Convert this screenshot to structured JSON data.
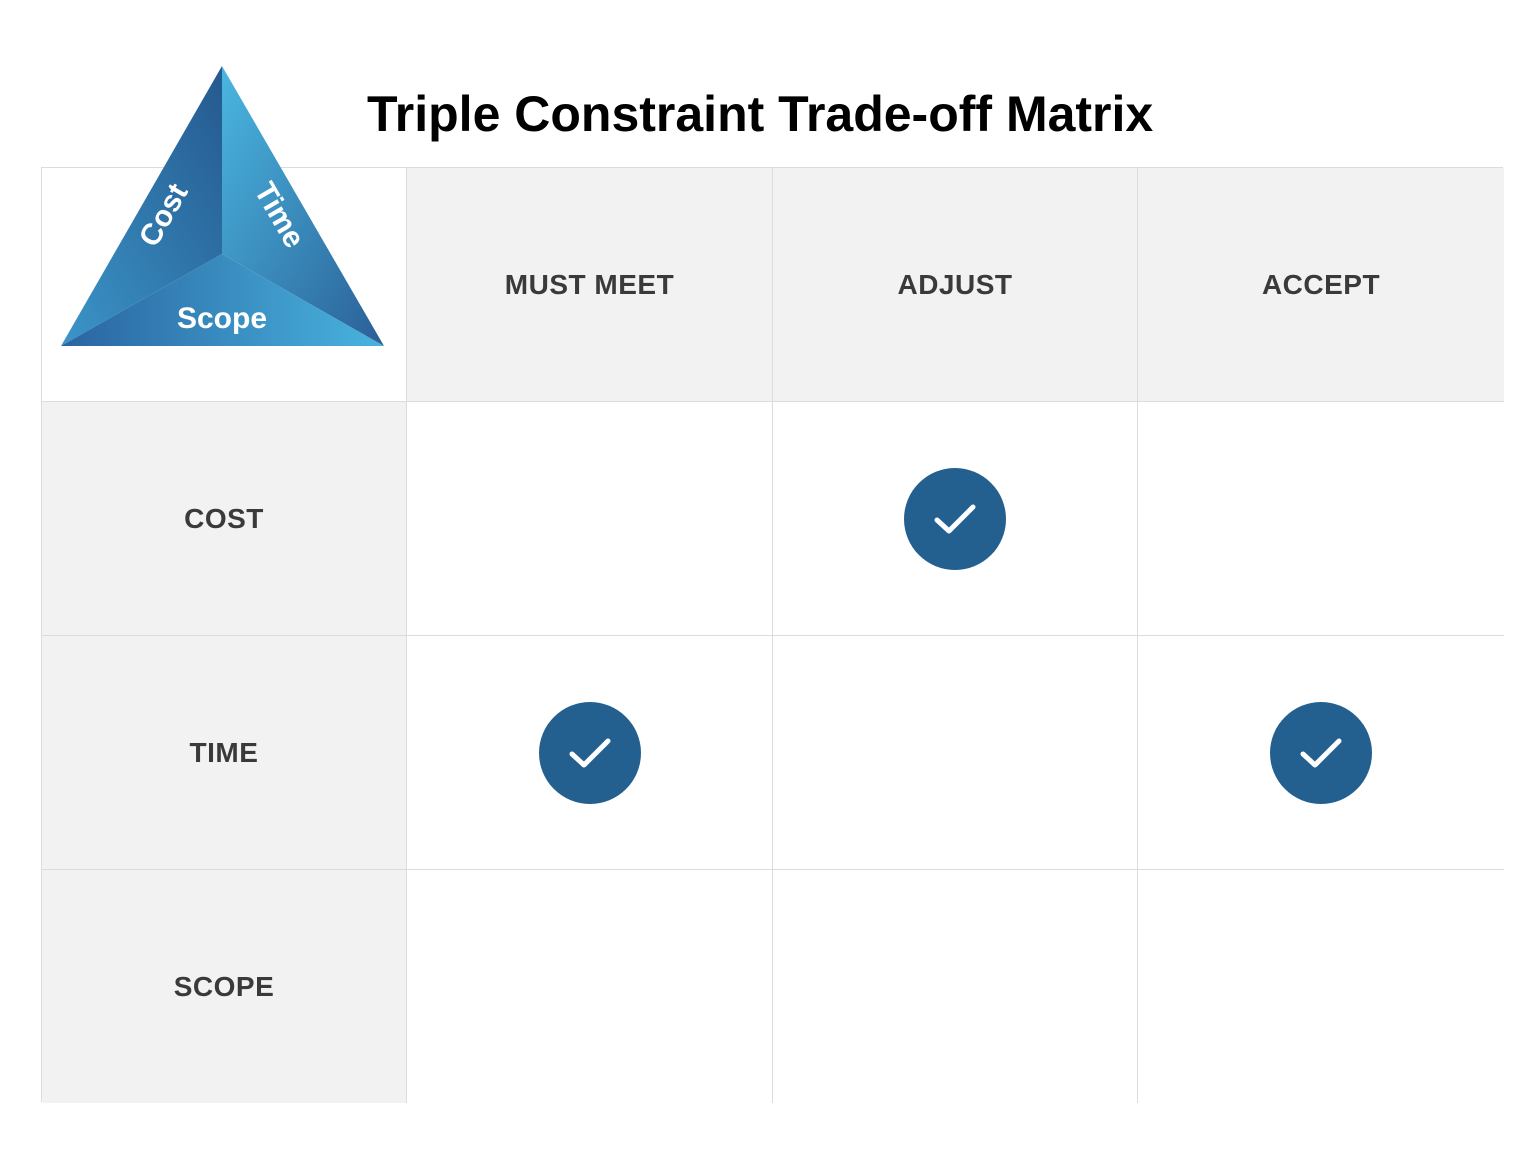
{
  "title": "Triple Constraint Trade-off Matrix",
  "triangle": {
    "labels": {
      "cost": "Cost",
      "time": "Time",
      "scope": "Scope"
    }
  },
  "columns": [
    "MUST MEET",
    "ADJUST",
    "ACCEPT"
  ],
  "rows": [
    {
      "label": "COST",
      "checks": [
        false,
        true,
        false
      ]
    },
    {
      "label": "TIME",
      "checks": [
        true,
        false,
        true
      ]
    },
    {
      "label": "SCOPE",
      "checks": [
        false,
        false,
        false
      ]
    }
  ],
  "colors": {
    "check_fill": "#235f8f",
    "header_bg": "#f2f2f2",
    "triangle_dark": "#2a5f96",
    "triangle_light": "#45b0dc"
  },
  "icons": {
    "check": "check-icon"
  }
}
